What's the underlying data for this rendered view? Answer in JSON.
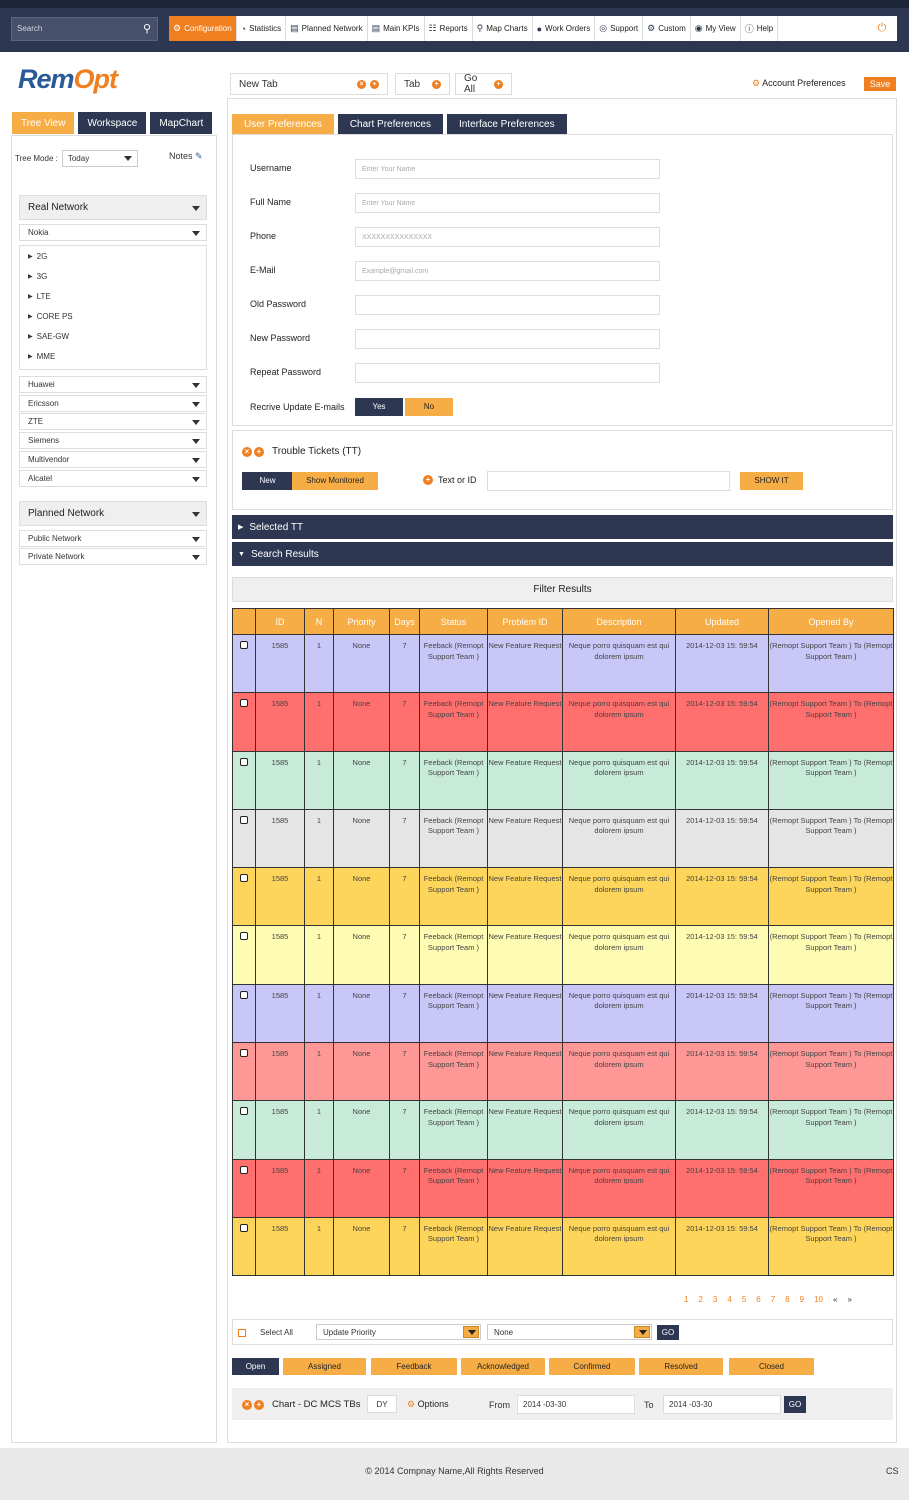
{
  "colors": {
    "navy": "#2d3752",
    "orange": "#f07f1f",
    "amber": "#f7ad45",
    "lavender": "#c9c7f7",
    "red": "#fe6f6e",
    "mint": "#c8ebd9",
    "gray": "#e5e5e5",
    "yellow": "#fdd55b",
    "paleyellow": "#fefcb3",
    "pink": "#fd9897"
  },
  "search": {
    "placeholder": "Search",
    "icon": "search-icon"
  },
  "nav": [
    {
      "label": "Configuration",
      "icon": "config-icon",
      "active": true
    },
    {
      "label": "Statistics",
      "icon": "pie-icon"
    },
    {
      "label": "Planned Network",
      "icon": "db-icon"
    },
    {
      "label": "Main KPIs",
      "icon": "db-icon"
    },
    {
      "label": "Reports",
      "icon": "doc-icon"
    },
    {
      "label": "Map Charts",
      "icon": "pin-icon"
    },
    {
      "label": "Work Orders",
      "icon": "users-icon"
    },
    {
      "label": "Support",
      "icon": "lifebuoy-icon"
    },
    {
      "label": "Custom",
      "icon": "cogs-icon"
    },
    {
      "label": "My View",
      "icon": "eye-icon"
    },
    {
      "label": "Help",
      "icon": "help-icon"
    }
  ],
  "logo": {
    "part1": "Rem",
    "part2": "Opt"
  },
  "left_tabs": [
    "Tree View",
    "Workspace",
    "MapChart"
  ],
  "tree_mode": {
    "label": "Tree Mode :",
    "value": "Today"
  },
  "notes": "Notes",
  "real_network": {
    "title": "Real Network",
    "vendor": "Nokia",
    "nodes": [
      "2G",
      "3G",
      "LTE",
      "CORE PS",
      "SAE-GW",
      "MME"
    ],
    "vendors": [
      "Huawei",
      "Ericsson",
      "ZTE",
      "Siemens",
      "Multivendor",
      "Alcatel"
    ]
  },
  "planned_network": {
    "title": "Planned Network",
    "items": [
      "Public Network",
      "Private Network"
    ]
  },
  "tabs": {
    "new_tab": "New Tab",
    "tab": "Tab",
    "go_all": "Go All"
  },
  "account": {
    "label": "Account Preferences",
    "save": "Save"
  },
  "pref_tabs": [
    "User Preferences",
    "Chart Preferences",
    "Interface Preferences"
  ],
  "form": {
    "username": {
      "label": "Username",
      "placeholder": "Enter Your Name"
    },
    "fullname": {
      "label": "Full Name",
      "placeholder": "Enter Your Name"
    },
    "phone": {
      "label": "Phone",
      "placeholder": "XXXXXXXXXXXXXXX"
    },
    "email": {
      "label": "E-Mail",
      "placeholder": "Example@gmail.com"
    },
    "old_pw": {
      "label": "Old Password",
      "placeholder": ""
    },
    "new_pw": {
      "label": "New Password",
      "placeholder": ""
    },
    "repeat_pw": {
      "label": "Repeat Password",
      "placeholder": ""
    },
    "receive": {
      "label": "Recrive Update E-mails",
      "yes": "Yes",
      "no": "No"
    }
  },
  "tt": {
    "title": "Trouble Tickets (TT)",
    "new": "New",
    "monitored": "Show Monitored",
    "text_id": "Text or ID",
    "show": "SHOW  IT"
  },
  "bars": {
    "selected": "Selected TT",
    "search": "Search Results"
  },
  "filter": "Filter Results",
  "table": {
    "headers": [
      "",
      "ID",
      "N",
      "Priority",
      "Days",
      "Status",
      "Problem ID",
      "Description",
      "Updated",
      "Opened By"
    ],
    "rows": [
      {
        "color": "lavender",
        "id": "1585",
        "n": "1",
        "priority": "None",
        "days": "7",
        "status": "Feeback (Remopt Support Team )",
        "problem": "New Feature Request",
        "desc": "Neque porro quisquam est qui dolorem ipsum",
        "updated": "2014-12-03 15: 59:54",
        "opened": "(Remopt Support Team ) To (Remopt Support Team )"
      },
      {
        "color": "red",
        "id": "1585",
        "n": "1",
        "priority": "None",
        "days": "7",
        "status": "Feeback (Remopt Support Team )",
        "problem": "New Feature Request",
        "desc": "Neque porro quisquam est qui dolorem ipsum",
        "updated": "2014-12-03 15: 59:54",
        "opened": "(Remopt Support Team ) To (Remopt Support Team )"
      },
      {
        "color": "mint",
        "id": "1585",
        "n": "1",
        "priority": "None",
        "days": "7",
        "status": "Feeback (Remopt Support Team )",
        "problem": "New Feature Request",
        "desc": "Neque porro quisquam est qui dolorem ipsum",
        "updated": "2014-12-03 15: 59:54",
        "opened": "(Remopt Support Team ) To (Remopt Support Team )"
      },
      {
        "color": "gray",
        "id": "1585",
        "n": "1",
        "priority": "None",
        "days": "7",
        "status": "Feeback (Remopt Support Team )",
        "problem": "New Feature Request",
        "desc": "Neque porro quisquam est qui dolorem ipsum",
        "updated": "2014-12-03 15: 59:54",
        "opened": "(Remopt Support Team ) To (Remopt Support Team )"
      },
      {
        "color": "yellow",
        "id": "1585",
        "n": "1",
        "priority": "None",
        "days": "7",
        "status": "Feeback (Remopt Support Team )",
        "problem": "New Feature Request",
        "desc": "Neque porro quisquam est qui dolorem ipsum",
        "updated": "2014-12-03 15: 59:54",
        "opened": "(Remopt Support Team ) To (Remopt Support Team )"
      },
      {
        "color": "paleyellow",
        "id": "1585",
        "n": "1",
        "priority": "None",
        "days": "7",
        "status": "Feeback (Remopt Support Team )",
        "problem": "New Feature Request",
        "desc": "Neque porro quisquam est qui dolorem ipsum",
        "updated": "2014-12-03 15: 59:54",
        "opened": "(Remopt Support Team ) To (Remopt Support Team )"
      },
      {
        "color": "lavender",
        "id": "1585",
        "n": "1",
        "priority": "None",
        "days": "7",
        "status": "Feeback (Remopt Support Team )",
        "problem": "New Feature Request",
        "desc": "Neque porro quisquam est qui dolorem ipsum",
        "updated": "2014-12-03 15: 59:54",
        "opened": "(Remopt Support Team ) To (Remopt Support Team )"
      },
      {
        "color": "pink",
        "id": "1585",
        "n": "1",
        "priority": "None",
        "days": "7",
        "status": "Feeback (Remopt Support Team )",
        "problem": "New Feature Request",
        "desc": "Neque porro quisquam est qui dolorem ipsum",
        "updated": "2014-12-03 15: 59:54",
        "opened": "(Remopt Support Team ) To (Remopt Support Team )"
      },
      {
        "color": "mint",
        "id": "1585",
        "n": "1",
        "priority": "None",
        "days": "7",
        "status": "Feeback (Remopt Support Team )",
        "problem": "New Feature Request",
        "desc": "Neque porro quisquam est qui dolorem ipsum",
        "updated": "2014-12-03 15: 59:54",
        "opened": "(Remopt Support Team ) To (Remopt Support Team )"
      },
      {
        "color": "red",
        "id": "1585",
        "n": "1",
        "priority": "None",
        "days": "7",
        "status": "Feeback (Remopt Support Team )",
        "problem": "New Feature Request",
        "desc": "Neque porro quisquam est qui dolorem ipsum",
        "updated": "2014-12-03 15: 59:54",
        "opened": "(Remopt Support Team ) To (Remopt Support Team )"
      },
      {
        "color": "yellow",
        "id": "1585",
        "n": "1",
        "priority": "None",
        "days": "7",
        "status": "Feeback (Remopt Support Team )",
        "problem": "New Feature Request",
        "desc": "Neque porro quisquam est qui dolorem ipsum",
        "updated": "2014-12-03 15: 59:54",
        "opened": "(Remopt Support Team ) To (Remopt Support Team )"
      }
    ]
  },
  "pager": [
    "1",
    "2",
    "3",
    "4",
    "5",
    "6",
    "7",
    "8",
    "9",
    "10",
    "«",
    "»"
  ],
  "actions": {
    "select_all": "Select All",
    "update_priority": "Update Priority",
    "none": "None",
    "go": "GO"
  },
  "statuses": [
    "Open",
    "Assigned",
    "Feedback",
    "Acknowledged",
    "Confirmed",
    "Resolved",
    "Closed"
  ],
  "chart": {
    "label": "Chart  - DC MCS TBs",
    "dy": "DY",
    "options": "Options",
    "from": "From",
    "from_val": "2014 -03-30",
    "to": "To",
    "to_val": "2014 -03-30",
    "go": "GO"
  },
  "footer": {
    "copyright": "© 2014 Compnay Name,All Rights Reserved",
    "cs": "CS"
  }
}
